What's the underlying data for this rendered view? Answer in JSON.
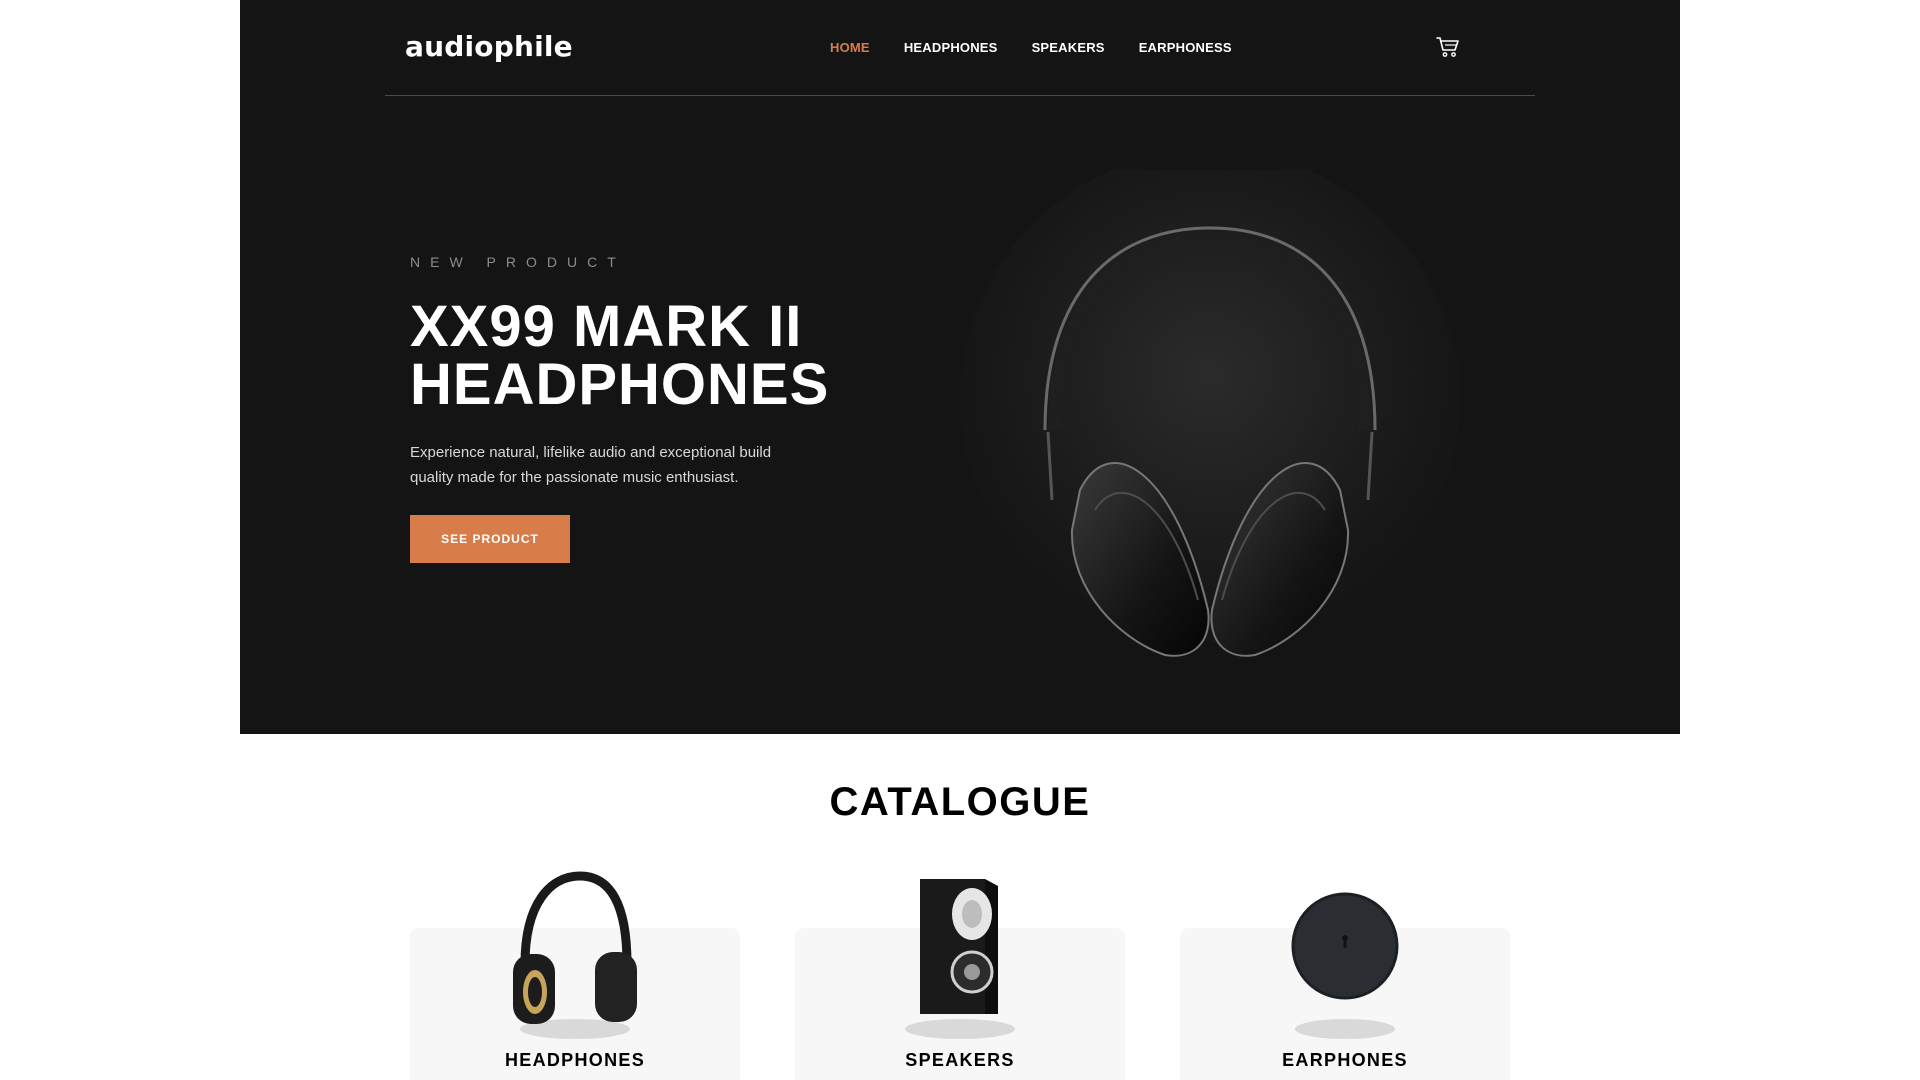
{
  "brand": {
    "logo": "audiophile"
  },
  "nav": {
    "links": [
      "HOME",
      "HEADPHONES",
      "SPEAKERS",
      "EARPHONESS"
    ],
    "active_index": 0
  },
  "hero": {
    "overline": "NEW PRODUCT",
    "title_line1": "XX99 MARK II",
    "title_line2": "HEADPHONES",
    "description": "Experience natural, lifelike audio and exceptional build quality made for the passionate music enthusiast.",
    "cta_label": "SEE PRODUCT",
    "image_icon": "headphones-hero-image"
  },
  "catalogue": {
    "title": "CATALOGUE",
    "cards": [
      {
        "label": "HEADPHONES",
        "icon": "headphones-icon"
      },
      {
        "label": "SPEAKERS",
        "icon": "speaker-icon"
      },
      {
        "label": "EARPHONES",
        "icon": "earphones-case-icon"
      }
    ]
  },
  "colors": {
    "accent": "#d87d4a",
    "hero_bg": "#141414",
    "card_bg": "#f7f7f7"
  }
}
